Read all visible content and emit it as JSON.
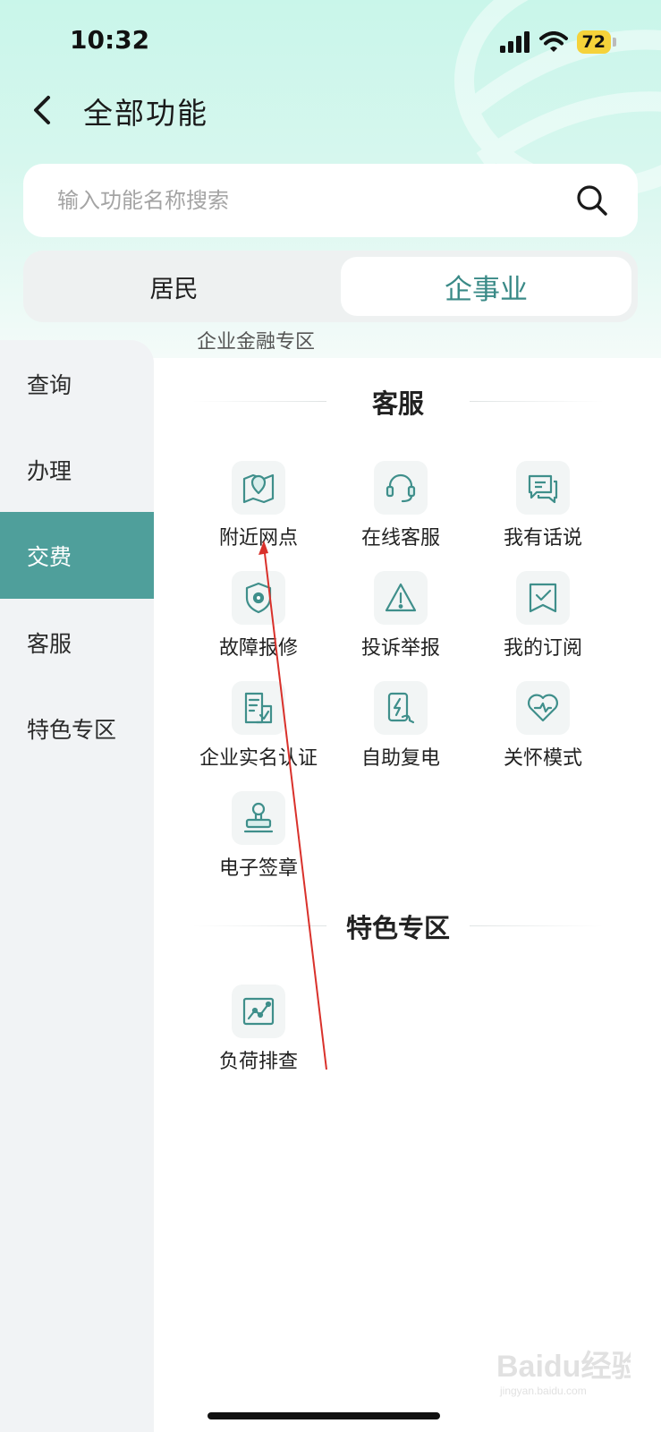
{
  "status_bar": {
    "time": "10:32",
    "battery": "72"
  },
  "header": {
    "title": "全部功能"
  },
  "search": {
    "placeholder": "输入功能名称搜索"
  },
  "segments": {
    "left": "居民",
    "right": "企事业"
  },
  "sidebar": {
    "items": [
      {
        "label": "查询"
      },
      {
        "label": "办理"
      },
      {
        "label": "交费"
      },
      {
        "label": "客服"
      },
      {
        "label": "特色专区"
      }
    ],
    "active_index": 2
  },
  "content": {
    "clipped_section_text": "企业金融专区",
    "sections": [
      {
        "title": "客服",
        "items": [
          {
            "label": "附近网点",
            "icon": "map-pin-icon"
          },
          {
            "label": "在线客服",
            "icon": "headset-icon"
          },
          {
            "label": "我有话说",
            "icon": "chat-icon"
          },
          {
            "label": "故障报修",
            "icon": "shield-gear-icon"
          },
          {
            "label": "投诉举报",
            "icon": "warning-icon"
          },
          {
            "label": "我的订阅",
            "icon": "bookmark-check-icon"
          },
          {
            "label": "企业实名认证",
            "icon": "document-check-icon"
          },
          {
            "label": "自助复电",
            "icon": "power-restore-icon"
          },
          {
            "label": "关怀模式",
            "icon": "heart-icon"
          },
          {
            "label": "电子签章",
            "icon": "stamp-icon"
          }
        ]
      },
      {
        "title": "特色专区",
        "items": [
          {
            "label": "负荷排查",
            "icon": "line-chart-icon"
          }
        ]
      }
    ]
  },
  "watermark": {
    "text": "Baidu经验",
    "subtext": "jingyan.baidu.com"
  },
  "colors": {
    "accent": "#4f9f9b",
    "accent_text": "#3a8a87",
    "icon_stroke": "#3f8f8b",
    "annotation": "#d9312b"
  }
}
